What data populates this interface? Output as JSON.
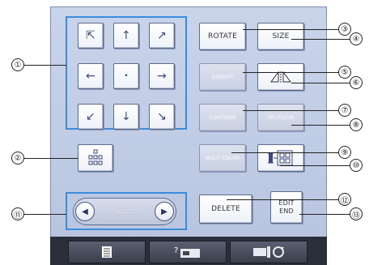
{
  "buttons": {
    "rotate": "ROTATE",
    "size": "SIZE",
    "density": "DENSITY",
    "mirror_icon": "mirror-icon",
    "dim1": "CONTINUE",
    "dim2": "SPLIT/JOIN",
    "multi_color": "MULTI COLOR",
    "delete": "DELETE",
    "edit_end_line1": "EDIT",
    "edit_end_line2": "END",
    "select": "SELECT"
  },
  "callouts": [
    "①",
    "②",
    "③",
    "④",
    "⑤",
    "⑥",
    "⑦",
    "⑧",
    "⑨",
    "⑩",
    "⑪",
    "⑫",
    "⑬"
  ],
  "colors": {
    "highlight": "#3a8dde",
    "screen_bg": "#c3cee6",
    "bottom_bar": "#2b2f3a"
  }
}
